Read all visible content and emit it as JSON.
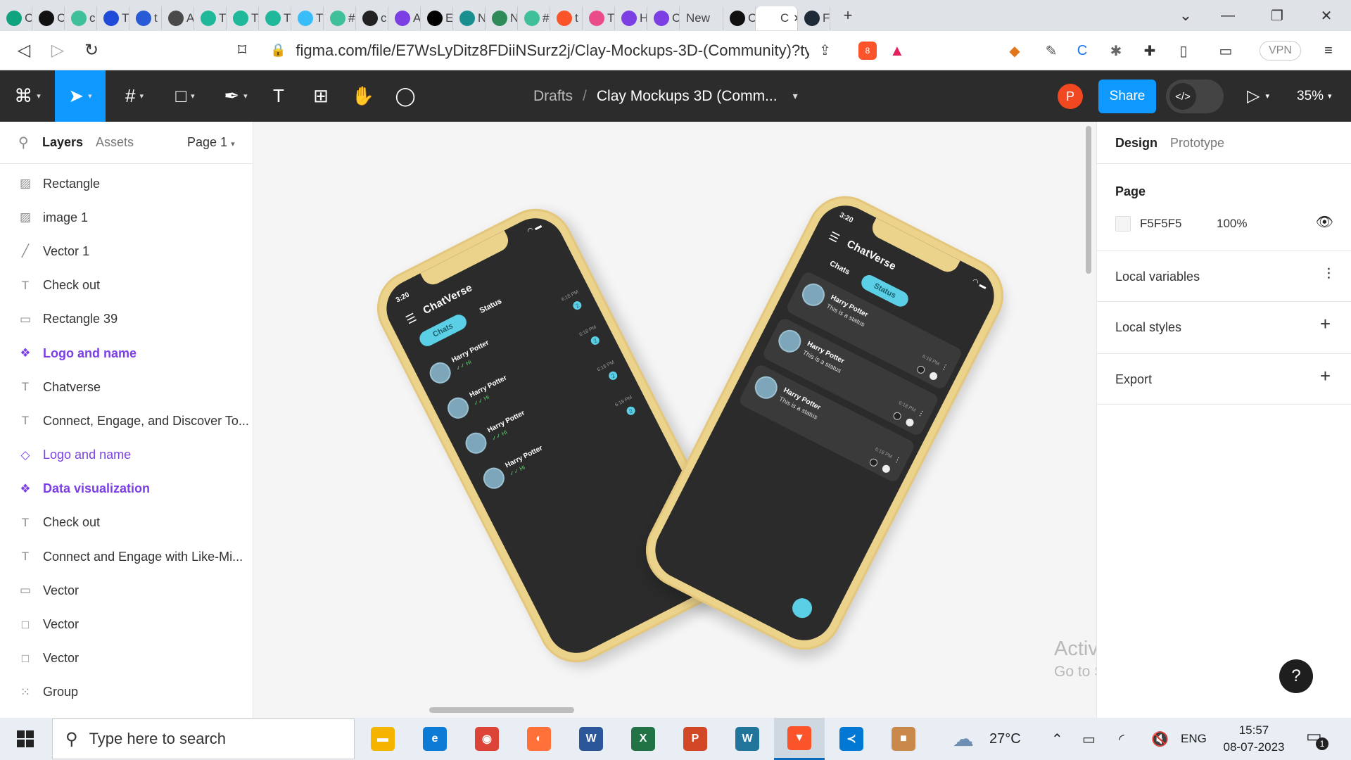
{
  "browser": {
    "tabs": [
      {
        "title": "C",
        "icon": "chatgpt-icon",
        "color": "#10a37f"
      },
      {
        "title": "C",
        "icon": "leaf-icon",
        "color": "#111111"
      },
      {
        "title": "c",
        "icon": "medium-m-icon",
        "color": "#3fbf9a"
      },
      {
        "title": "T",
        "icon": "play-circle-icon",
        "color": "#1f4bd8"
      },
      {
        "title": "t",
        "icon": "e-logo-icon",
        "color": "#2a5bd7"
      },
      {
        "title": "A",
        "icon": "user-avatar-icon",
        "color": "#4a4a4a"
      },
      {
        "title": "T",
        "icon": "feather-icon",
        "color": "#1fb89a"
      },
      {
        "title": "T",
        "icon": "feather-icon",
        "color": "#1fb89a"
      },
      {
        "title": "T",
        "icon": "feather-icon",
        "color": "#1fb89a"
      },
      {
        "title": "T",
        "icon": "tailwind-icon",
        "color": "#38bdf8"
      },
      {
        "title": "#",
        "icon": "medium-m-icon",
        "color": "#3fbf9a"
      },
      {
        "title": "c",
        "icon": "github-icon",
        "color": "#222222"
      },
      {
        "title": "A",
        "icon": "a-logo-icon",
        "color": "#7b3fe4"
      },
      {
        "title": "E",
        "icon": "medium-dots-icon",
        "color": "#000000"
      },
      {
        "title": "N",
        "icon": "m-square-icon",
        "color": "#1a8f8f"
      },
      {
        "title": "N",
        "icon": "link-icon",
        "color": "#2e8b57"
      },
      {
        "title": "#",
        "icon": "medium-m-icon",
        "color": "#3fbf9a"
      },
      {
        "title": "t",
        "icon": "brave-icon",
        "color": "#fb542b"
      },
      {
        "title": "T",
        "icon": "dribbble-icon",
        "color": "#ea4c89"
      },
      {
        "title": "H",
        "icon": "shield-icon",
        "color": "#7b3fe4"
      },
      {
        "title": "C",
        "icon": "a-logo-icon",
        "color": "#7b3fe4"
      },
      {
        "title": "New",
        "icon": "",
        "color": "#dfe3e8"
      },
      {
        "title": "C",
        "icon": "framer-icon",
        "color": "#111111"
      },
      {
        "title": "C",
        "icon": "figma-icon",
        "color": "#ffffff"
      },
      {
        "title": "F",
        "icon": "react-icon",
        "color": "#1e2a38"
      }
    ],
    "url": "figma.com/file/E7WsLyDitz8FDiiNSurz2j/Clay-Mockups-3D-(Community)?ty...",
    "brave_badge": "8",
    "vpn_label": "VPN"
  },
  "figma": {
    "toolbar": {
      "breadcrumb_parent": "Drafts",
      "breadcrumb_sep": "/",
      "file_name": "Clay Mockups 3D (Comm...",
      "avatar_letter": "P",
      "avatar_color": "#f24822",
      "share_label": "Share",
      "zoom": "35%",
      "accent": "#0d99ff"
    },
    "left_panel": {
      "tab_layers": "Layers",
      "tab_assets": "Assets",
      "page_label": "Page 1",
      "layers": [
        {
          "name": "Rectangle",
          "icon": "image-icon",
          "kind": "normal"
        },
        {
          "name": "image 1",
          "icon": "image-icon",
          "kind": "normal"
        },
        {
          "name": "Vector 1",
          "icon": "line-icon",
          "kind": "normal"
        },
        {
          "name": "Check out",
          "icon": "text-icon",
          "kind": "normal"
        },
        {
          "name": "Rectangle 39",
          "icon": "rectangle-icon",
          "kind": "normal"
        },
        {
          "name": "Logo and name",
          "icon": "component-icon",
          "kind": "component"
        },
        {
          "name": "Chatverse",
          "icon": "text-icon",
          "kind": "normal"
        },
        {
          "name": "Connect, Engage, and Discover To...",
          "icon": "text-icon",
          "kind": "normal"
        },
        {
          "name": "Logo and name",
          "icon": "instance-icon",
          "kind": "instance"
        },
        {
          "name": "Data visualization",
          "icon": "component-icon",
          "kind": "component"
        },
        {
          "name": "Check out",
          "icon": "text-icon",
          "kind": "normal"
        },
        {
          "name": "Connect and Engage with Like-Mi...",
          "icon": "text-icon",
          "kind": "normal"
        },
        {
          "name": "Vector",
          "icon": "rectangle-icon",
          "kind": "normal"
        },
        {
          "name": "Vector",
          "icon": "square-icon",
          "kind": "normal"
        },
        {
          "name": "Vector",
          "icon": "square-icon",
          "kind": "normal"
        },
        {
          "name": "Group",
          "icon": "group-icon",
          "kind": "normal"
        }
      ]
    },
    "canvas": {
      "phone_left": {
        "time": "3:20",
        "app_title": "ChatVerse",
        "tab_chats": "Chats",
        "tab_status": "Status",
        "chats": [
          {
            "name": "Harry Potter",
            "msg": "✓✓ Hi",
            "time": "6:18 PM",
            "badge": "2"
          },
          {
            "name": "Harry Potter",
            "msg": "✓✓ Hi",
            "time": "6:18 PM",
            "badge": "2"
          },
          {
            "name": "Harry Potter",
            "msg": "✓✓ Hi",
            "time": "6:18 PM",
            "badge": "2"
          },
          {
            "name": "Harry Potter",
            "msg": "✓✓ Hi",
            "time": "6:18 PM",
            "badge": "2"
          }
        ]
      },
      "phone_right": {
        "time": "3:20",
        "app_title": "ChatVerse",
        "tab_chats": "Chats",
        "tab_status": "Status",
        "statuses": [
          {
            "name": "Harry Potter",
            "msg": "This is a status",
            "time": "6:18 PM"
          },
          {
            "name": "Harry Potter",
            "msg": "This is a status",
            "time": "6:18 PM"
          },
          {
            "name": "Harry Potter",
            "msg": "This is a status",
            "time": "6:18 PM"
          }
        ]
      },
      "phone_color": "#ecd38c",
      "screen_color": "#2b2b2b",
      "app_accent": "#5bcfe6",
      "watermark_title": "Activate Windows",
      "watermark_sub": "Go to Settings to activate Windows."
    },
    "right_panel": {
      "tab_design": "Design",
      "tab_prototype": "Prototype",
      "page_heading": "Page",
      "page_color_hex": "F5F5F5",
      "page_opacity": "100%",
      "local_variables": "Local variables",
      "local_styles": "Local styles",
      "export": "Export"
    }
  },
  "taskbar": {
    "search_placeholder": "Type here to search",
    "apps": [
      {
        "name": "file-explorer",
        "color": "#f5b400",
        "glyph": "▬"
      },
      {
        "name": "edge",
        "color": "#0c7bd6",
        "glyph": "e"
      },
      {
        "name": "chrome",
        "color": "#db4437",
        "glyph": "◉"
      },
      {
        "name": "firefox",
        "color": "#ff7139",
        "glyph": "◐"
      },
      {
        "name": "word",
        "color": "#2b579a",
        "glyph": "W"
      },
      {
        "name": "excel",
        "color": "#217346",
        "glyph": "X"
      },
      {
        "name": "powerpoint",
        "color": "#d24726",
        "glyph": "P"
      },
      {
        "name": "wordpress",
        "color": "#21759b",
        "glyph": "W"
      },
      {
        "name": "brave",
        "color": "#fb542b",
        "glyph": "▼"
      },
      {
        "name": "vscode",
        "color": "#0078d4",
        "glyph": "≺"
      },
      {
        "name": "package",
        "color": "#c8894a",
        "glyph": "■"
      }
    ],
    "weather": "27°C",
    "language": "ENG",
    "time": "15:57",
    "date": "08-07-2023",
    "notification_count": "1"
  }
}
